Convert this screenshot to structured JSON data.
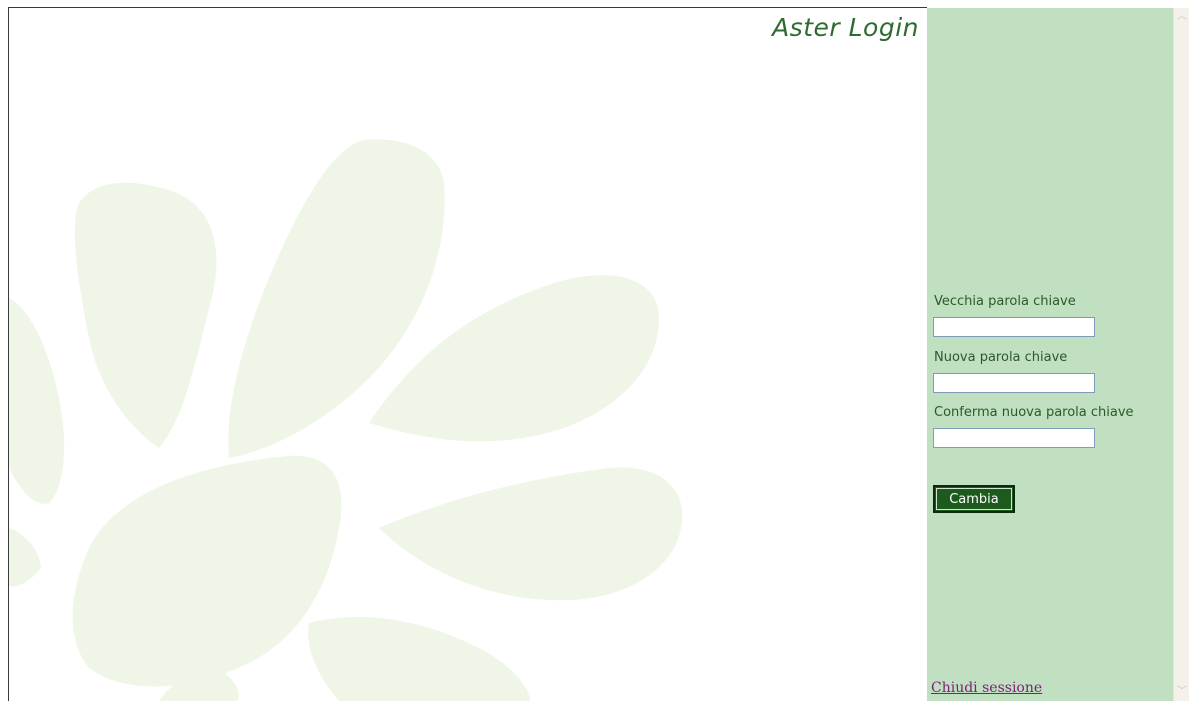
{
  "header": {
    "title": "Aster Login"
  },
  "form": {
    "old_password_label": "Vecchia parola chiave",
    "old_password_value": "",
    "new_password_label": "Nuova parola chiave",
    "new_password_value": "",
    "confirm_password_label": "Conferma nuova parola chiave",
    "confirm_password_value": "",
    "submit_label": "Cambia"
  },
  "footer": {
    "logout_label": "Chiudi sessione"
  },
  "scrollbar": {
    "up_glyph": "︿",
    "down_glyph": "﹀"
  },
  "colors": {
    "panel_bg": "#c1dfc1",
    "title": "#2f6b2f",
    "button_bg": "#1d5a1d",
    "flower": "#eff6e7",
    "link": "#7a1f7a"
  }
}
